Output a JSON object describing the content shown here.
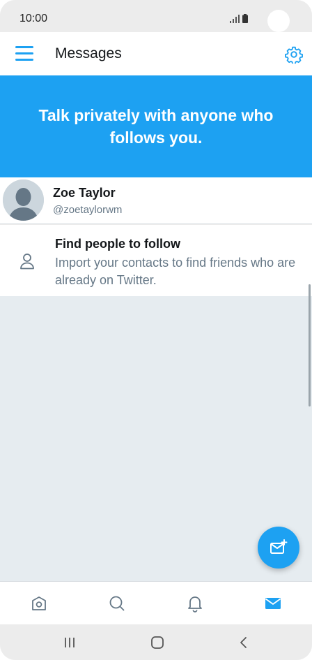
{
  "status_bar": {
    "time": "10:00"
  },
  "app_bar": {
    "title": "Messages",
    "menu_icon": "hamburger-menu-icon",
    "settings_icon": "gear-icon"
  },
  "banner": {
    "text": "Talk privately with anyone who follows you."
  },
  "user": {
    "name": "Zoe Taylor",
    "handle": "@zoetaylorwm"
  },
  "find_people": {
    "title": "Find people to follow",
    "description": "Import your contacts to find friends who are already on Twitter."
  },
  "fab": {
    "icon": "new-message-icon"
  },
  "bottom_nav": {
    "tabs": [
      {
        "icon": "home-icon"
      },
      {
        "icon": "search-icon"
      },
      {
        "icon": "bell-icon"
      },
      {
        "icon": "mail-icon",
        "active": true
      }
    ]
  },
  "system_nav": {
    "buttons": [
      "recents-icon",
      "home-button-icon",
      "back-icon"
    ]
  },
  "colors": {
    "accent": "#1da1f2",
    "background_empty": "#e6ecf0",
    "text_primary": "#14171a",
    "text_secondary": "#657786"
  }
}
